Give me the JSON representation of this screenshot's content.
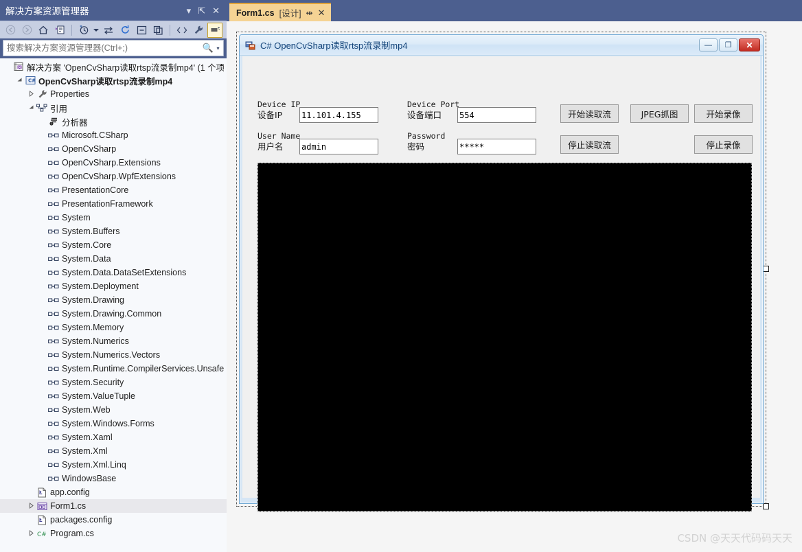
{
  "solution_explorer": {
    "title": "解决方案资源管理器",
    "title_buttons": [
      {
        "name": "dropdown",
        "glyph": "▾"
      },
      {
        "name": "pin",
        "glyph": "⇱"
      },
      {
        "name": "close",
        "glyph": "✕"
      }
    ],
    "toolbar": [
      {
        "name": "back-icon",
        "glyph": "⬅",
        "state": "disabled"
      },
      {
        "name": "forward-icon",
        "glyph": "➡",
        "state": "disabled"
      },
      {
        "name": "home-icon",
        "glyph": "⌂",
        "state": "normal"
      },
      {
        "name": "pending-changes-icon",
        "glyph": "▤",
        "state": "normal"
      },
      {
        "name": "separator-1",
        "glyph": "",
        "state": "sep"
      },
      {
        "name": "history-clock-icon",
        "glyph": "◷",
        "state": "normal"
      },
      {
        "name": "history-dropdown-icon",
        "glyph": "▾",
        "state": "normal"
      },
      {
        "name": "sync-with-active-document-icon",
        "glyph": "⇆",
        "state": "normal"
      },
      {
        "name": "refresh-icon",
        "glyph": "↻",
        "state": "normal"
      },
      {
        "name": "collapse-all-icon",
        "glyph": "⊟",
        "state": "normal"
      },
      {
        "name": "show-all-files-icon",
        "glyph": "❐",
        "state": "normal"
      },
      {
        "name": "separator-2",
        "glyph": "",
        "state": "sep"
      },
      {
        "name": "view-code-icon",
        "glyph": "‹›",
        "state": "normal"
      },
      {
        "name": "properties-wrench-icon",
        "glyph": "🔧",
        "state": "normal"
      },
      {
        "name": "view-designer-icon",
        "glyph": "▭",
        "state": "active"
      }
    ],
    "search": {
      "placeholder": "搜索解决方案资源管理器(Ctrl+;)",
      "value": "",
      "icon": "search-icon",
      "dropdown_glyph": "▾"
    },
    "tree": [
      {
        "indent": 0,
        "twisty": "",
        "icon": "solution-icon",
        "label": "解决方案 'OpenCvSharp读取rtsp流录制mp4' (1 个项",
        "bold": false,
        "selected": false
      },
      {
        "indent": 1,
        "twisty": "▴",
        "icon": "csharp-project-icon",
        "label": "OpenCvSharp读取rtsp流录制mp4",
        "bold": true,
        "selected": false
      },
      {
        "indent": 2,
        "twisty": "▸",
        "icon": "wrench-icon",
        "label": "Properties",
        "bold": false,
        "selected": false
      },
      {
        "indent": 2,
        "twisty": "▴",
        "icon": "references-icon",
        "label": "引用",
        "bold": false,
        "selected": false
      },
      {
        "indent": 3,
        "twisty": "",
        "icon": "analyzers-icon",
        "label": "分析器",
        "bold": false,
        "selected": false
      },
      {
        "indent": 3,
        "twisty": "",
        "icon": "reference-icon",
        "label": "Microsoft.CSharp",
        "bold": false,
        "selected": false
      },
      {
        "indent": 3,
        "twisty": "",
        "icon": "reference-icon",
        "label": "OpenCvSharp",
        "bold": false,
        "selected": false
      },
      {
        "indent": 3,
        "twisty": "",
        "icon": "reference-icon",
        "label": "OpenCvSharp.Extensions",
        "bold": false,
        "selected": false
      },
      {
        "indent": 3,
        "twisty": "",
        "icon": "reference-icon",
        "label": "OpenCvSharp.WpfExtensions",
        "bold": false,
        "selected": false
      },
      {
        "indent": 3,
        "twisty": "",
        "icon": "reference-icon",
        "label": "PresentationCore",
        "bold": false,
        "selected": false
      },
      {
        "indent": 3,
        "twisty": "",
        "icon": "reference-icon",
        "label": "PresentationFramework",
        "bold": false,
        "selected": false
      },
      {
        "indent": 3,
        "twisty": "",
        "icon": "reference-icon",
        "label": "System",
        "bold": false,
        "selected": false
      },
      {
        "indent": 3,
        "twisty": "",
        "icon": "reference-icon",
        "label": "System.Buffers",
        "bold": false,
        "selected": false
      },
      {
        "indent": 3,
        "twisty": "",
        "icon": "reference-icon",
        "label": "System.Core",
        "bold": false,
        "selected": false
      },
      {
        "indent": 3,
        "twisty": "",
        "icon": "reference-icon",
        "label": "System.Data",
        "bold": false,
        "selected": false
      },
      {
        "indent": 3,
        "twisty": "",
        "icon": "reference-icon",
        "label": "System.Data.DataSetExtensions",
        "bold": false,
        "selected": false
      },
      {
        "indent": 3,
        "twisty": "",
        "icon": "reference-icon",
        "label": "System.Deployment",
        "bold": false,
        "selected": false
      },
      {
        "indent": 3,
        "twisty": "",
        "icon": "reference-icon",
        "label": "System.Drawing",
        "bold": false,
        "selected": false
      },
      {
        "indent": 3,
        "twisty": "",
        "icon": "reference-icon",
        "label": "System.Drawing.Common",
        "bold": false,
        "selected": false
      },
      {
        "indent": 3,
        "twisty": "",
        "icon": "reference-icon",
        "label": "System.Memory",
        "bold": false,
        "selected": false
      },
      {
        "indent": 3,
        "twisty": "",
        "icon": "reference-icon",
        "label": "System.Numerics",
        "bold": false,
        "selected": false
      },
      {
        "indent": 3,
        "twisty": "",
        "icon": "reference-icon",
        "label": "System.Numerics.Vectors",
        "bold": false,
        "selected": false
      },
      {
        "indent": 3,
        "twisty": "",
        "icon": "reference-icon",
        "label": "System.Runtime.CompilerServices.Unsafe",
        "bold": false,
        "selected": false
      },
      {
        "indent": 3,
        "twisty": "",
        "icon": "reference-icon",
        "label": "System.Security",
        "bold": false,
        "selected": false
      },
      {
        "indent": 3,
        "twisty": "",
        "icon": "reference-icon",
        "label": "System.ValueTuple",
        "bold": false,
        "selected": false
      },
      {
        "indent": 3,
        "twisty": "",
        "icon": "reference-icon",
        "label": "System.Web",
        "bold": false,
        "selected": false
      },
      {
        "indent": 3,
        "twisty": "",
        "icon": "reference-icon",
        "label": "System.Windows.Forms",
        "bold": false,
        "selected": false
      },
      {
        "indent": 3,
        "twisty": "",
        "icon": "reference-icon",
        "label": "System.Xaml",
        "bold": false,
        "selected": false
      },
      {
        "indent": 3,
        "twisty": "",
        "icon": "reference-icon",
        "label": "System.Xml",
        "bold": false,
        "selected": false
      },
      {
        "indent": 3,
        "twisty": "",
        "icon": "reference-icon",
        "label": "System.Xml.Linq",
        "bold": false,
        "selected": false
      },
      {
        "indent": 3,
        "twisty": "",
        "icon": "reference-icon",
        "label": "WindowsBase",
        "bold": false,
        "selected": false
      },
      {
        "indent": 2,
        "twisty": "",
        "icon": "config-file-icon",
        "label": "app.config",
        "bold": false,
        "selected": false
      },
      {
        "indent": 2,
        "twisty": "▸",
        "icon": "form-icon",
        "label": "Form1.cs",
        "bold": false,
        "selected": true
      },
      {
        "indent": 2,
        "twisty": "",
        "icon": "config-file-icon",
        "label": "packages.config",
        "bold": false,
        "selected": false
      },
      {
        "indent": 2,
        "twisty": "▸",
        "icon": "cs-file-icon",
        "label": "Program.cs",
        "bold": false,
        "selected": false
      }
    ]
  },
  "document_tab": {
    "name": "Form1.cs",
    "suffix": "[设计]",
    "pin_glyph": "⇹",
    "close_glyph": "✕"
  },
  "form_designer": {
    "window": {
      "icon": "winform-icon",
      "title": "C# OpenCvSharp读取rtsp流录制mp4",
      "buttons": [
        {
          "name": "minimize-button",
          "glyph": "—"
        },
        {
          "name": "maximize-button",
          "glyph": "❐"
        },
        {
          "name": "close-button",
          "glyph": "✕"
        }
      ]
    },
    "fields": [
      {
        "name": "device-ip",
        "label_en": "Device IP",
        "label_cn": "设备IP",
        "value": "11.101.4.155"
      },
      {
        "name": "device-port",
        "label_en": "Device Port",
        "label_cn": "设备端口",
        "value": "554"
      },
      {
        "name": "user-name",
        "label_en": "User Name",
        "label_cn": "用户名",
        "value": "admin"
      },
      {
        "name": "password",
        "label_en": "Password",
        "label_cn": "密码",
        "value": "*****"
      }
    ],
    "buttons": [
      {
        "name": "start-stream-button",
        "label": "开始读取流"
      },
      {
        "name": "jpeg-capture-button",
        "label": "JPEG抓图"
      },
      {
        "name": "start-record-button",
        "label": "开始录像"
      },
      {
        "name": "stop-stream-button",
        "label": "停止读取流"
      },
      {
        "name": "stop-record-button",
        "label": "停止录像"
      }
    ],
    "video_panel": {
      "name": "video-preview-panel",
      "color": "#000000"
    }
  },
  "watermark": "CSDN @天天代码码天天",
  "colors": {
    "vs_chrome": "#4c5f8f",
    "toolbar": "#c7cfe2",
    "tree_bg": "#f7f9fc",
    "tab_active": "#f5d394",
    "tab_accent": "#e0a33a",
    "form_chrome": "#d6e6f5",
    "form_body": "#f0f0f0",
    "close_button": "#c22c22"
  }
}
